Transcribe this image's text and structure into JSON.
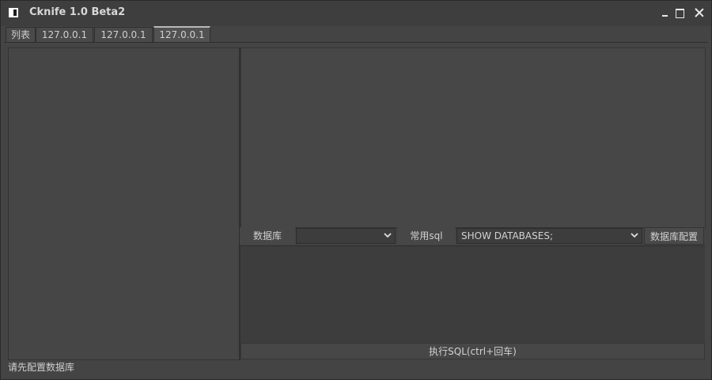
{
  "window": {
    "title": "Cknife 1.0 Beta2",
    "controls": [
      "minimize-icon",
      "maximize-icon",
      "close-icon"
    ]
  },
  "tabs": [
    {
      "label": "列表",
      "active": false
    },
    {
      "label": "127.0.0.1",
      "active": false
    },
    {
      "label": "127.0.0.1",
      "active": false
    },
    {
      "label": "127.0.0.1",
      "active": true
    }
  ],
  "db_toolbar": {
    "database_label": "数据库",
    "database_select_value": "",
    "common_sql_label": "常用sql",
    "common_sql_value": "SHOW DATABASES;",
    "config_button_label": "数据库配置"
  },
  "execute_button_label": "执行SQL(ctrl+回车)",
  "status_text": "请先配置数据库",
  "colors": {
    "background": "#444444",
    "titlebar": "#3e3e3e",
    "text": "#d2d2d2"
  }
}
